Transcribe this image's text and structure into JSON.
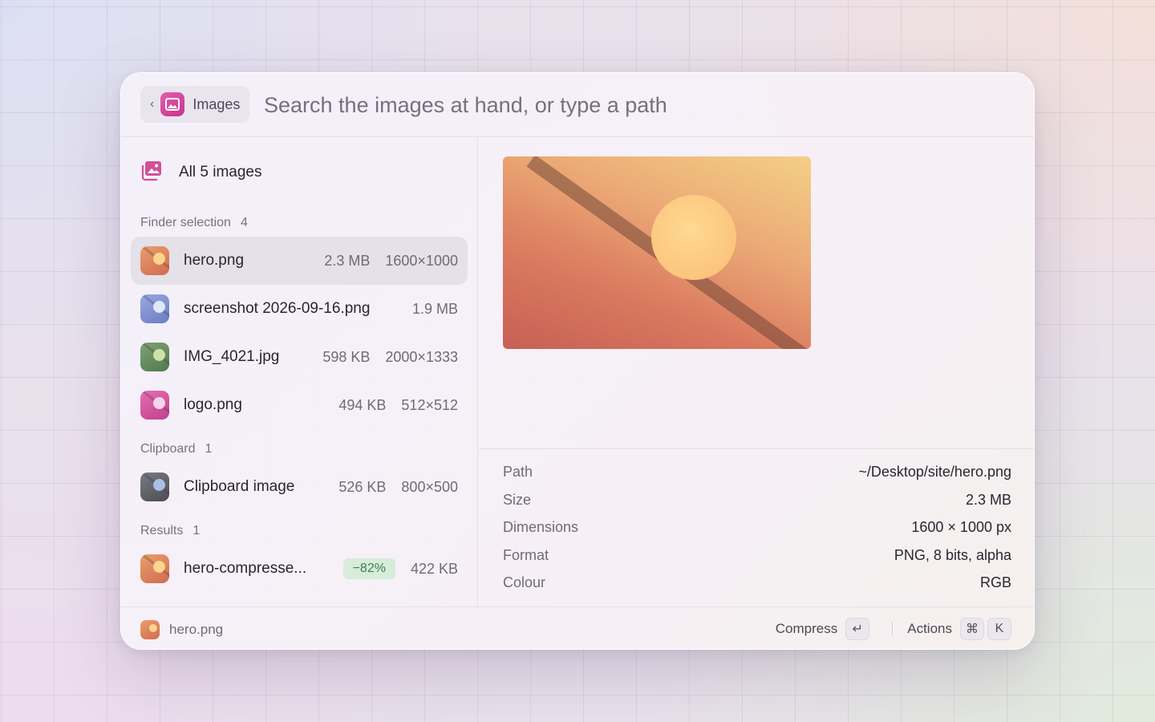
{
  "header": {
    "scope_label": "Images",
    "search_placeholder": "Search the images at hand, or type a path"
  },
  "all_images": {
    "label": "All 5 images"
  },
  "sections": [
    {
      "title": "Finder selection",
      "count": "4"
    },
    {
      "title": "Clipboard",
      "count": "1"
    },
    {
      "title": "Results",
      "count": "1"
    }
  ],
  "items": [
    {
      "name": "hero.png",
      "size": "2.3 MB",
      "dims": "1600×1000",
      "selected": true
    },
    {
      "name": "screenshot 2026-09-16.png",
      "size": "1.9 MB",
      "dims": ""
    },
    {
      "name": "IMG_4021.jpg",
      "size": "598 KB",
      "dims": "2000×1333"
    },
    {
      "name": "logo.png",
      "size": "494 KB",
      "dims": "512×512"
    },
    {
      "name": "Clipboard image",
      "size": "526 KB",
      "dims": "800×500"
    },
    {
      "name": "hero-compresse...",
      "badge": "−82%",
      "size": "422 KB"
    }
  ],
  "thumb_colors": [
    "#e07d5d",
    "#7f8fcf",
    "#5f8a5a",
    "#d24f9c",
    "#5d5d66",
    "#e07d5d"
  ],
  "details": [
    {
      "key": "Path",
      "value": "~/Desktop/site/hero.png"
    },
    {
      "key": "Size",
      "value": "2.3 MB"
    },
    {
      "key": "Dimensions",
      "value": "1600 × 1000 px"
    },
    {
      "key": "Format",
      "value": "PNG, 8 bits, alpha"
    },
    {
      "key": "Colour",
      "value": "RGB"
    }
  ],
  "footer": {
    "current_file": "hero.png",
    "primary_action": "Compress",
    "primary_key": "↵",
    "actions_label": "Actions",
    "actions_keys": [
      "⌘",
      "K"
    ]
  }
}
